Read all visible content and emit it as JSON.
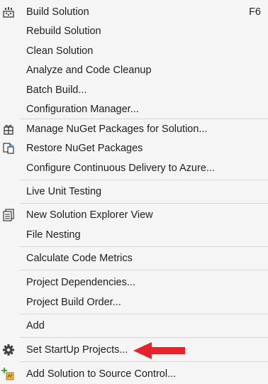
{
  "menu": {
    "items": [
      {
        "label": "Build Solution",
        "shortcut": "F6",
        "icon": "build-solution-icon"
      },
      {
        "label": "Rebuild Solution"
      },
      {
        "label": "Clean Solution"
      },
      {
        "label": "Analyze and Code Cleanup"
      },
      {
        "label": "Batch Build..."
      },
      {
        "label": "Configuration Manager..."
      },
      {
        "label": "Manage NuGet Packages for Solution...",
        "icon": "nuget-package-icon"
      },
      {
        "label": "Restore NuGet Packages",
        "icon": "restore-packages-icon"
      },
      {
        "label": "Configure Continuous Delivery to Azure..."
      },
      {
        "label": "Live Unit Testing"
      },
      {
        "label": "New Solution Explorer View",
        "icon": "solution-explorer-icon"
      },
      {
        "label": "File Nesting"
      },
      {
        "label": "Calculate Code Metrics"
      },
      {
        "label": "Project Dependencies..."
      },
      {
        "label": "Project Build Order..."
      },
      {
        "label": "Add"
      },
      {
        "label": "Set StartUp Projects...",
        "icon": "gear-icon"
      },
      {
        "label": "Add Solution to Source Control...",
        "icon": "add-source-control-icon"
      }
    ]
  },
  "annotation": {
    "arrow_color": "#e8212a",
    "points_to": "Set StartUp Projects..."
  }
}
